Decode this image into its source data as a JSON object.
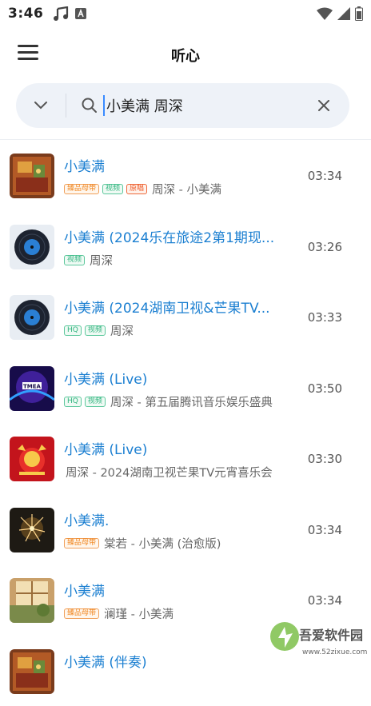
{
  "status": {
    "time": "3:46"
  },
  "header": {
    "title": "听心"
  },
  "search": {
    "value": "小美满 周深"
  },
  "songs": [
    {
      "title": "小美满",
      "badges": [
        {
          "text": "臻品母带",
          "kind": "orange"
        },
        {
          "text": "视频",
          "kind": "green"
        },
        {
          "text": "原唱",
          "kind": "red"
        }
      ],
      "subtitle": "周深 - 小美满",
      "duration": "03:34",
      "cover": "album-art"
    },
    {
      "title": " 小美满 (2024乐在旅途2第1期现...",
      "badges": [
        {
          "text": "视频",
          "kind": "green"
        }
      ],
      "subtitle": "周深",
      "duration": "03:26",
      "cover": "vinyl"
    },
    {
      "title": " 小美满 (2024湖南卫视&芒果TV...",
      "badges": [
        {
          "text": "HQ",
          "kind": "green"
        },
        {
          "text": "视频",
          "kind": "green"
        }
      ],
      "subtitle": "周深",
      "duration": "03:33",
      "cover": "vinyl"
    },
    {
      "title": "小美满 (Live)",
      "badges": [
        {
          "text": "HQ",
          "kind": "green"
        },
        {
          "text": "视频",
          "kind": "green"
        }
      ],
      "subtitle": "周深 - 第五届腾讯音乐娱乐盛典",
      "duration": "03:50",
      "cover": "tmea"
    },
    {
      "title": "小美满 (Live)",
      "badges": [],
      "subtitle": "周深 - 2024湖南卫视芒果TV元宵喜乐会",
      "duration": "03:30",
      "cover": "festival"
    },
    {
      "title": "小美满.",
      "badges": [
        {
          "text": "臻品母带",
          "kind": "orange"
        }
      ],
      "subtitle": "棠若 - 小美满 (治愈版)",
      "duration": "03:34",
      "cover": "sparkler"
    },
    {
      "title": "小美满",
      "badges": [
        {
          "text": "臻品母带",
          "kind": "orange"
        }
      ],
      "subtitle": "澜瑾 - 小美满",
      "duration": "03:34",
      "cover": "window"
    },
    {
      "title": "小美满 (伴奏)",
      "badges": [],
      "subtitle": "",
      "duration": "",
      "cover": "album-art"
    }
  ],
  "watermark": {
    "brand": "吾爱软件园",
    "url": "www.52zixue.com"
  },
  "colors": {
    "title": "#1b7fd1",
    "accent": "#3a8bff",
    "search_bg": "#eef2f8"
  }
}
